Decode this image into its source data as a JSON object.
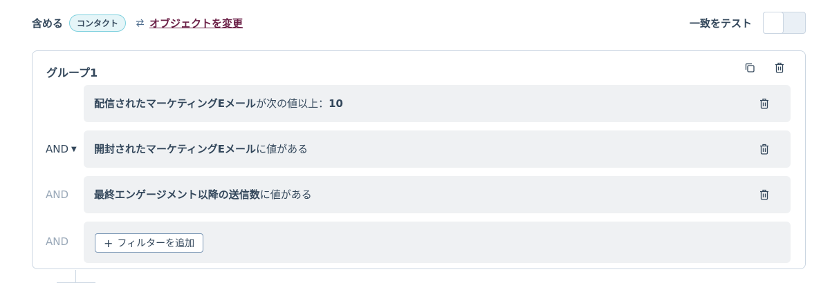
{
  "header": {
    "include_label": "含める",
    "object_pill": "コンタクト",
    "change_object_link": "オブジェクトを変更",
    "test_match_label": "一致をテスト",
    "test_match_enabled": false
  },
  "group": {
    "title": "グループ1",
    "filters": [
      {
        "property": "配信されたマーケティングEメール",
        "condition_prefix": "が次の値以上：",
        "value": "10"
      },
      {
        "connector": "AND",
        "property": "開封されたマーケティングEメール",
        "condition": "に値がある"
      },
      {
        "connector": "AND",
        "property": "最終エンゲージメント以降の送信数",
        "condition": "に値がある"
      }
    ],
    "add_filter": {
      "connector": "AND",
      "plus": "+",
      "label": "フィルターを追加"
    }
  },
  "icons": {
    "swap": "swap-arrows-icon",
    "copy": "copy-icon",
    "delete": "trash-icon",
    "caret": "caret-down-icon"
  },
  "colors": {
    "text": "#33475b",
    "muted": "#99a8b8",
    "pill_bg": "#e5f5f8",
    "pill_border": "#7fd1de",
    "link": "#6b1f46",
    "row_bg": "#eff1f3",
    "border": "#cbd6e2"
  }
}
